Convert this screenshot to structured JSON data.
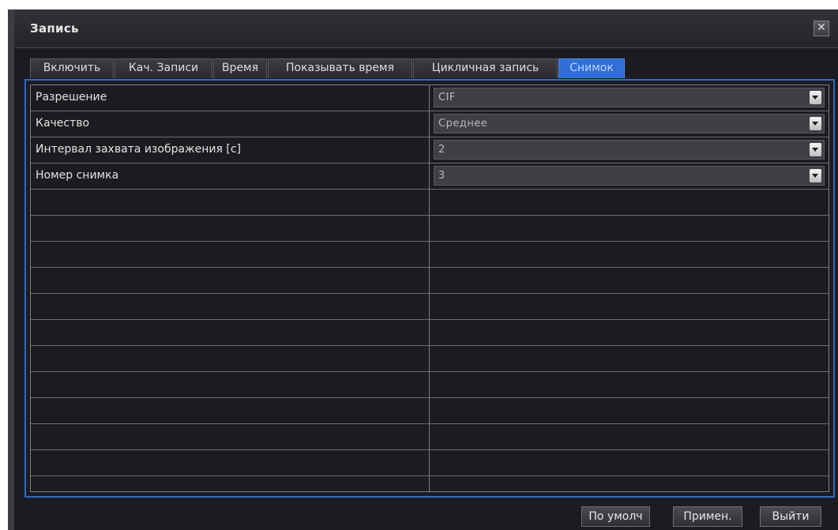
{
  "window": {
    "title": "Запись",
    "close_glyph": "✕"
  },
  "tabs": [
    {
      "label": "Включить"
    },
    {
      "label": "Кач. Записи"
    },
    {
      "label": "Время"
    },
    {
      "label": "Показывать время"
    },
    {
      "label": "Цикличная запись"
    },
    {
      "label": "Снимок",
      "active": true
    }
  ],
  "settings": [
    {
      "label": "Разрешение",
      "value": "CIF"
    },
    {
      "label": "Качество",
      "value": "Среднее"
    },
    {
      "label": "Интервал захвата изображения [c]",
      "value": "2"
    },
    {
      "label": "Номер снимка",
      "value": "3"
    }
  ],
  "buttons": {
    "default": "По умолч",
    "apply": "Примен.",
    "exit": "Выйти"
  },
  "colors": {
    "accent": "#2f6fd6",
    "background": "#1b1c1f",
    "text": "#e3e3e3"
  }
}
